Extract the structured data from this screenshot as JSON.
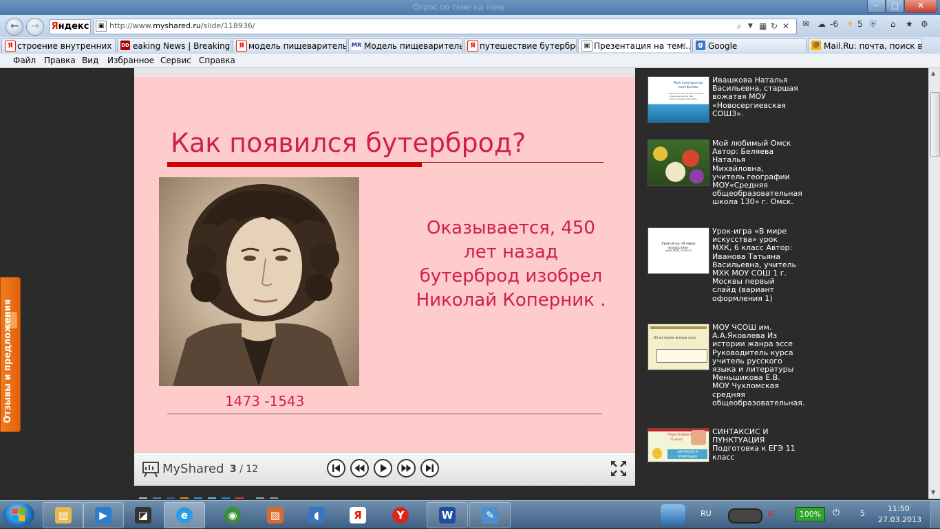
{
  "window": {
    "title": "Опрос по теме на тему",
    "min": "–",
    "max": "□",
    "close": "✕"
  },
  "navbar": {
    "yandex_logo": [
      "Я",
      "ндекс"
    ],
    "url_prefix": "http://www.",
    "url_host": "myshared.ru",
    "url_path": "/slide/118936/",
    "mail_count": "-6",
    "weather": "5"
  },
  "tabs": [
    {
      "label": "строение внутренних о...",
      "icon": "yandex-favicon",
      "glyph": "Я"
    },
    {
      "label": "eaking News | Breaking ...",
      "icon": "dnews-favicon",
      "glyph": "DD"
    },
    {
      "label": "модель пищеваритель...",
      "icon": "yandex-favicon",
      "glyph": "Я"
    },
    {
      "label": "Модель пищеваритель...",
      "icon": "mr-favicon",
      "glyph": "MR"
    },
    {
      "label": "путешествие бутербро...",
      "icon": "yandex-favicon",
      "glyph": "Я"
    },
    {
      "label": "Презентация на тем...",
      "icon": "slide-favicon",
      "glyph": "▣",
      "active": true,
      "close": "✕"
    },
    {
      "label": "Google",
      "icon": "google-favicon",
      "glyph": "g"
    },
    {
      "label": "Mail.Ru: почта, поиск в ...",
      "icon": "mail-favicon",
      "glyph": "@"
    }
  ],
  "menu": [
    "Файл",
    "Правка",
    "Вид",
    "Избранное",
    "Сервис",
    "Справка"
  ],
  "slide": {
    "title": "Как появился бутерброд?",
    "text": "Оказывается, 450 лет назад бутерброд изобрел Николай Коперник .",
    "years": "1473 -1543"
  },
  "player": {
    "logo": "MyShared",
    "current": "3",
    "total": "/ 12"
  },
  "feedback_tab": "Отзывы и предложения",
  "related": [
    {
      "text": "Ивашкова Наталья Васильевна, старшая вожатая МОУ «Новосергиевская СОШ3».",
      "thumb": {
        "title": "Мой конкурсное портфолио",
        "sub": "Ивашкова Наталья Васильевна, старшая вожатая МОУ «Новосергиевская СОШ3»"
      }
    },
    {
      "text": "Мой любимый Омск Автор: Беляева Наталья Михайловна, учитель географии МОУ«Средняя общеобразовательная школа 130» г. Омск."
    },
    {
      "text": "Урок-игра «В мире искусства» урок МХК, 6 класс Автор: Иванова Татьяна Васильевна, учитель МХК МОУ СОШ 1 г. Москвы первый слайд (вариант оформления 1)",
      "thumb": {
        "title": "Урок-игра «В мире искусства»",
        "sub": "урок МХК, 6 класс"
      }
    },
    {
      "text": "МОУ ЧСОШ им. А.А.Яковлева Из истории жанра эссе Руководитель курса учитель русского языка и литературы Меньшикова Е.В. МОУ Чухломская средняя общеобразовательная.",
      "thumb": {
        "title": "Из истории жанра эссе"
      }
    },
    {
      "text": "СИНТАКСИС И ПУНКТУАЦИЯ Подготовка к ЕГЭ 11 класс",
      "thumb": {
        "title": "Подготовка к ЕГЭ",
        "sub": "11 класс",
        "label": "СИНТАКСИС И ПУНКТУАЦИЯ"
      }
    }
  ],
  "taskbar": {
    "apps": [
      {
        "name": "explorer",
        "glyph": "▤",
        "color": "#e8b94a"
      },
      {
        "name": "media-player",
        "glyph": "▶",
        "color": "#2e7ad1"
      },
      {
        "name": "scanner",
        "glyph": "◪",
        "color": "#333"
      },
      {
        "name": "internet-explorer",
        "glyph": "e",
        "color": "#2d9be5",
        "active": true
      },
      {
        "name": "browser-green",
        "glyph": "◉",
        "color": "#3b8f3b"
      },
      {
        "name": "paint-app",
        "glyph": "▧",
        "color": "#d96a2b"
      },
      {
        "name": "volume-app",
        "glyph": "◖",
        "color": "#3a74c0"
      },
      {
        "name": "yandex-app",
        "glyph": "Я",
        "color": "#e61400"
      },
      {
        "name": "yandex-browser",
        "glyph": "Y",
        "color": "#d8261a"
      },
      {
        "name": "word",
        "glyph": "W",
        "color": "#1f4e9e"
      },
      {
        "name": "notepad",
        "glyph": "✎",
        "color": "#4b8fd0"
      }
    ],
    "lang": "RU",
    "battery": "100%",
    "tray_num": "5",
    "time": "11:50",
    "date": "27.03.2013"
  }
}
